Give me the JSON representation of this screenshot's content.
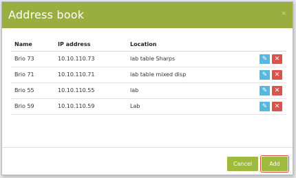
{
  "dialog": {
    "title": "Address book",
    "close_glyph": "×"
  },
  "table": {
    "headers": {
      "name": "Name",
      "ip": "IP address",
      "location": "Location"
    },
    "rows": [
      {
        "name": "Brio 73",
        "ip": "10.10.110.73",
        "location": "lab table Sharps"
      },
      {
        "name": "Brio 71",
        "ip": "10.10.110.71",
        "location": "lab table mixed disp"
      },
      {
        "name": "Brio 55",
        "ip": "10.10.110.55",
        "location": "lab"
      },
      {
        "name": "Brio 59",
        "ip": "10.10.110.59",
        "location": "Lab"
      }
    ],
    "edit_icon": "edit-icon",
    "delete_icon": "delete-icon",
    "edit_glyph": "✎",
    "delete_glyph": "✕"
  },
  "footer": {
    "cancel_label": "Cancel",
    "add_label": "Add"
  },
  "colors": {
    "titlebar": "#99ae3e",
    "button": "#9fbb3f",
    "edit": "#58b7de",
    "delete": "#d9534f",
    "highlight": "#e0433a"
  }
}
